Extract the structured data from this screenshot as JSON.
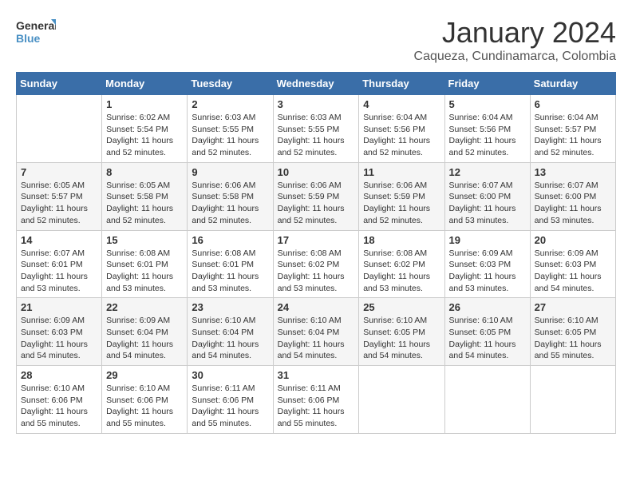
{
  "logo": {
    "line1": "General",
    "line2": "Blue"
  },
  "title": "January 2024",
  "location": "Caqueza, Cundinamarca, Colombia",
  "weekdays": [
    "Sunday",
    "Monday",
    "Tuesday",
    "Wednesday",
    "Thursday",
    "Friday",
    "Saturday"
  ],
  "weeks": [
    [
      {
        "day": "",
        "sunrise": "",
        "sunset": "",
        "daylight": ""
      },
      {
        "day": "1",
        "sunrise": "Sunrise: 6:02 AM",
        "sunset": "Sunset: 5:54 PM",
        "daylight": "Daylight: 11 hours and 52 minutes."
      },
      {
        "day": "2",
        "sunrise": "Sunrise: 6:03 AM",
        "sunset": "Sunset: 5:55 PM",
        "daylight": "Daylight: 11 hours and 52 minutes."
      },
      {
        "day": "3",
        "sunrise": "Sunrise: 6:03 AM",
        "sunset": "Sunset: 5:55 PM",
        "daylight": "Daylight: 11 hours and 52 minutes."
      },
      {
        "day": "4",
        "sunrise": "Sunrise: 6:04 AM",
        "sunset": "Sunset: 5:56 PM",
        "daylight": "Daylight: 11 hours and 52 minutes."
      },
      {
        "day": "5",
        "sunrise": "Sunrise: 6:04 AM",
        "sunset": "Sunset: 5:56 PM",
        "daylight": "Daylight: 11 hours and 52 minutes."
      },
      {
        "day": "6",
        "sunrise": "Sunrise: 6:04 AM",
        "sunset": "Sunset: 5:57 PM",
        "daylight": "Daylight: 11 hours and 52 minutes."
      }
    ],
    [
      {
        "day": "7",
        "sunrise": "Sunrise: 6:05 AM",
        "sunset": "Sunset: 5:57 PM",
        "daylight": "Daylight: 11 hours and 52 minutes."
      },
      {
        "day": "8",
        "sunrise": "Sunrise: 6:05 AM",
        "sunset": "Sunset: 5:58 PM",
        "daylight": "Daylight: 11 hours and 52 minutes."
      },
      {
        "day": "9",
        "sunrise": "Sunrise: 6:06 AM",
        "sunset": "Sunset: 5:58 PM",
        "daylight": "Daylight: 11 hours and 52 minutes."
      },
      {
        "day": "10",
        "sunrise": "Sunrise: 6:06 AM",
        "sunset": "Sunset: 5:59 PM",
        "daylight": "Daylight: 11 hours and 52 minutes."
      },
      {
        "day": "11",
        "sunrise": "Sunrise: 6:06 AM",
        "sunset": "Sunset: 5:59 PM",
        "daylight": "Daylight: 11 hours and 52 minutes."
      },
      {
        "day": "12",
        "sunrise": "Sunrise: 6:07 AM",
        "sunset": "Sunset: 6:00 PM",
        "daylight": "Daylight: 11 hours and 53 minutes."
      },
      {
        "day": "13",
        "sunrise": "Sunrise: 6:07 AM",
        "sunset": "Sunset: 6:00 PM",
        "daylight": "Daylight: 11 hours and 53 minutes."
      }
    ],
    [
      {
        "day": "14",
        "sunrise": "Sunrise: 6:07 AM",
        "sunset": "Sunset: 6:01 PM",
        "daylight": "Daylight: 11 hours and 53 minutes."
      },
      {
        "day": "15",
        "sunrise": "Sunrise: 6:08 AM",
        "sunset": "Sunset: 6:01 PM",
        "daylight": "Daylight: 11 hours and 53 minutes."
      },
      {
        "day": "16",
        "sunrise": "Sunrise: 6:08 AM",
        "sunset": "Sunset: 6:01 PM",
        "daylight": "Daylight: 11 hours and 53 minutes."
      },
      {
        "day": "17",
        "sunrise": "Sunrise: 6:08 AM",
        "sunset": "Sunset: 6:02 PM",
        "daylight": "Daylight: 11 hours and 53 minutes."
      },
      {
        "day": "18",
        "sunrise": "Sunrise: 6:08 AM",
        "sunset": "Sunset: 6:02 PM",
        "daylight": "Daylight: 11 hours and 53 minutes."
      },
      {
        "day": "19",
        "sunrise": "Sunrise: 6:09 AM",
        "sunset": "Sunset: 6:03 PM",
        "daylight": "Daylight: 11 hours and 53 minutes."
      },
      {
        "day": "20",
        "sunrise": "Sunrise: 6:09 AM",
        "sunset": "Sunset: 6:03 PM",
        "daylight": "Daylight: 11 hours and 54 minutes."
      }
    ],
    [
      {
        "day": "21",
        "sunrise": "Sunrise: 6:09 AM",
        "sunset": "Sunset: 6:03 PM",
        "daylight": "Daylight: 11 hours and 54 minutes."
      },
      {
        "day": "22",
        "sunrise": "Sunrise: 6:09 AM",
        "sunset": "Sunset: 6:04 PM",
        "daylight": "Daylight: 11 hours and 54 minutes."
      },
      {
        "day": "23",
        "sunrise": "Sunrise: 6:10 AM",
        "sunset": "Sunset: 6:04 PM",
        "daylight": "Daylight: 11 hours and 54 minutes."
      },
      {
        "day": "24",
        "sunrise": "Sunrise: 6:10 AM",
        "sunset": "Sunset: 6:04 PM",
        "daylight": "Daylight: 11 hours and 54 minutes."
      },
      {
        "day": "25",
        "sunrise": "Sunrise: 6:10 AM",
        "sunset": "Sunset: 6:05 PM",
        "daylight": "Daylight: 11 hours and 54 minutes."
      },
      {
        "day": "26",
        "sunrise": "Sunrise: 6:10 AM",
        "sunset": "Sunset: 6:05 PM",
        "daylight": "Daylight: 11 hours and 54 minutes."
      },
      {
        "day": "27",
        "sunrise": "Sunrise: 6:10 AM",
        "sunset": "Sunset: 6:05 PM",
        "daylight": "Daylight: 11 hours and 55 minutes."
      }
    ],
    [
      {
        "day": "28",
        "sunrise": "Sunrise: 6:10 AM",
        "sunset": "Sunset: 6:06 PM",
        "daylight": "Daylight: 11 hours and 55 minutes."
      },
      {
        "day": "29",
        "sunrise": "Sunrise: 6:10 AM",
        "sunset": "Sunset: 6:06 PM",
        "daylight": "Daylight: 11 hours and 55 minutes."
      },
      {
        "day": "30",
        "sunrise": "Sunrise: 6:11 AM",
        "sunset": "Sunset: 6:06 PM",
        "daylight": "Daylight: 11 hours and 55 minutes."
      },
      {
        "day": "31",
        "sunrise": "Sunrise: 6:11 AM",
        "sunset": "Sunset: 6:06 PM",
        "daylight": "Daylight: 11 hours and 55 minutes."
      },
      {
        "day": "",
        "sunrise": "",
        "sunset": "",
        "daylight": ""
      },
      {
        "day": "",
        "sunrise": "",
        "sunset": "",
        "daylight": ""
      },
      {
        "day": "",
        "sunrise": "",
        "sunset": "",
        "daylight": ""
      }
    ]
  ]
}
